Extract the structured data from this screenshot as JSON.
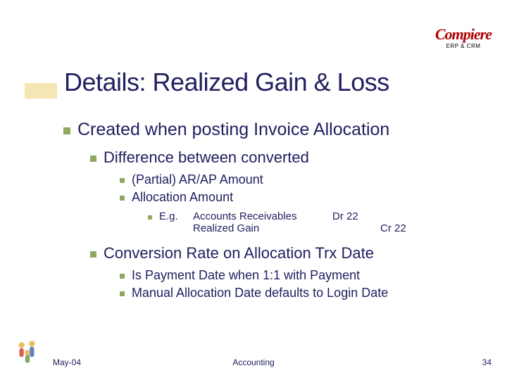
{
  "logo": {
    "brand": "Compiere",
    "tagline": "ERP & CRM"
  },
  "title": "Details: Realized Gain & Loss",
  "b1": "Created when posting Invoice Allocation",
  "b1_1": "Difference between converted",
  "b1_1_1": "(Partial) AR/AP Amount",
  "b1_1_2": "Allocation Amount",
  "eg_label": "E.g.",
  "eg_l1_acct": "Accounts Receivables",
  "eg_l1_dr": "Dr 22",
  "eg_l2_acct": "Realized Gain",
  "eg_l2_cr": "Cr 22",
  "b1_2": "Conversion Rate on Allocation Trx Date",
  "b1_2_1": "Is Payment Date when 1:1 with Payment",
  "b1_2_2": "Manual Allocation Date defaults to Login Date",
  "footer": {
    "left": "May-04",
    "center": "Accounting",
    "right": "34"
  }
}
